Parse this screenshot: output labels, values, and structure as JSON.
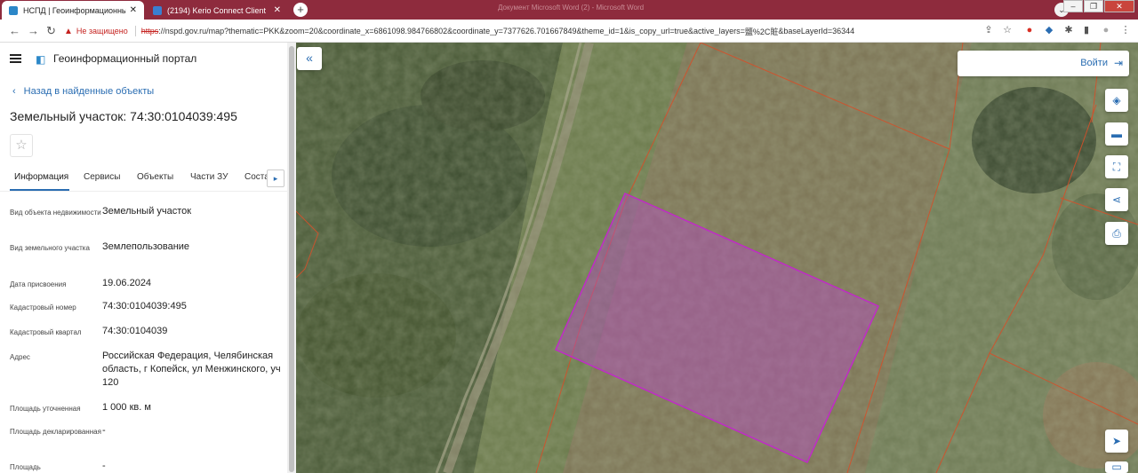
{
  "browser": {
    "tabs": [
      {
        "title": "НСПД | Геоинформационный п",
        "active": true
      },
      {
        "title": "(2194) Kerio Connect Client",
        "active": false
      }
    ],
    "window_title": "Документ Microsoft Word (2) - Microsoft Word",
    "insecure_label": "Не защищено",
    "url_scheme": "https",
    "url_rest": "://nspd.gov.ru/map?thematic=PKK&zoom=20&coordinate_x=6861098.984766802&coordinate_y=7377626.701667849&theme_id=1&is_copy_url=true&active_layers=",
    "url_tail": "&baseLayerId=36344",
    "url_glyph": "鹽%2C賍"
  },
  "panel": {
    "app_title": "Геоинформационный портал",
    "back_label": "Назад в найденные объекты",
    "object_title": "Земельный участок: 74:30:0104039:495",
    "tabs": [
      "Информация",
      "Сервисы",
      "Объекты",
      "Части ЗУ",
      "Состав"
    ],
    "rows": [
      {
        "key": "Вид объекта недвижимости",
        "value": "Земельный участок"
      },
      {
        "key": "Вид земельного участка",
        "value": "Землепользование"
      },
      {
        "key": "Дата присвоения",
        "value": "19.06.2024"
      },
      {
        "key": "Кадастровый номер",
        "value": "74:30:0104039:495"
      },
      {
        "key": "Кадастровый квартал",
        "value": "74:30:0104039"
      },
      {
        "key": "Адрес",
        "value": "Российская Федерация, Челябинская область, г Копейск, ул Менжинского, уч 120"
      },
      {
        "key": "Площадь уточненная",
        "value": "1 000 кв. м"
      },
      {
        "key": "Площадь декларированная",
        "value": "-"
      },
      {
        "key": "Площадь",
        "value": "-"
      }
    ]
  },
  "map": {
    "login_label": "Войти",
    "tools": [
      "layers-icon",
      "ruler-icon",
      "select-area-icon",
      "share-icon",
      "print-icon",
      "locate-icon",
      "extra-tool-icon"
    ],
    "parcel_color": "#c02bc7",
    "boundary_color": "#d4502a"
  }
}
